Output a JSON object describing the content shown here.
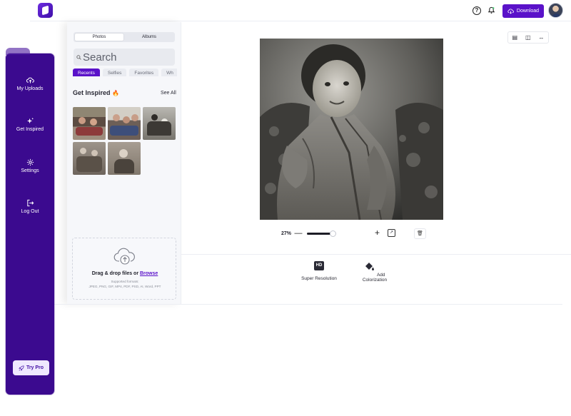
{
  "topbar": {
    "help_icon": "?",
    "download_label": "Download",
    "colors": {
      "accent": "#5a12c9",
      "sidebar": "#3b0a8f"
    }
  },
  "sidebar": {
    "items": [
      {
        "label": "My Uploads",
        "icon": "cloud-upload-icon"
      },
      {
        "label": "Get Inspired",
        "icon": "sparkle-icon"
      },
      {
        "label": "Settings",
        "icon": "gear-icon"
      },
      {
        "label": "Log Out",
        "icon": "logout-icon"
      }
    ],
    "try_pro_label": "Try Pro"
  },
  "gallery": {
    "tabs": [
      "Photos",
      "Albums"
    ],
    "search_placeholder": "Search",
    "chips": [
      "Recents",
      "Selfies",
      "Favorites",
      "Wh"
    ],
    "inspired_title": "Get Inspired",
    "see_all_label": "See All"
  },
  "dropzone": {
    "title_prefix": "Drag & drop files or ",
    "browse_label": "Browse",
    "formats_heading": "Supported formats:",
    "formats_list": "JPEG, PNG, GIF, MP4, PDF, PSD, AI, Word, PPT"
  },
  "canvas": {
    "zoom_label": "27%",
    "zoom_level": 0.27
  },
  "tools": {
    "super_resolution_badge": "HD",
    "super_resolution_label": "Super Resolution",
    "colorization_label": "Add Colorization"
  }
}
